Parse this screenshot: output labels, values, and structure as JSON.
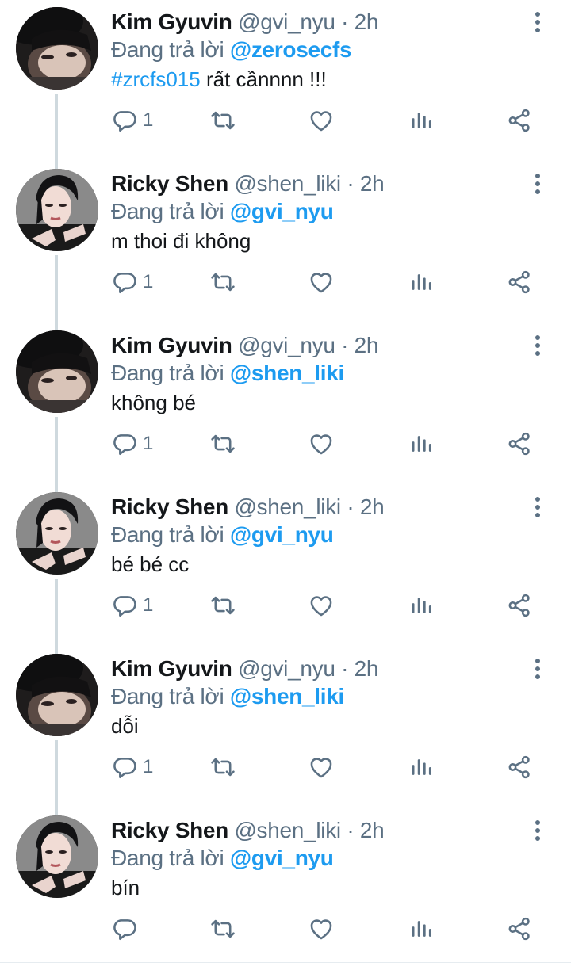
{
  "colors": {
    "accent": "#1d9bf0",
    "secondary_text": "#5b7083",
    "primary_text": "#14171a",
    "thread_line": "#cfd9de"
  },
  "tweets": [
    {
      "author": "Kim Gyuvin",
      "handle": "@gvi_nyu",
      "separator": "·",
      "time": "2h",
      "reply_prefix": "Đang trả lời",
      "reply_to": "@zerosecfs",
      "hashtag": "#zrcfs015",
      "text": " rất cầnnnn !!!",
      "reply_count": "1",
      "avatar": "kim-gyuvin-avatar"
    },
    {
      "author": "Ricky Shen",
      "handle": "@shen_liki",
      "separator": "·",
      "time": "2h",
      "reply_prefix": "Đang trả lời",
      "reply_to": "@gvi_nyu",
      "hashtag": "",
      "text": "m thoi đi không",
      "reply_count": "1",
      "avatar": "ricky-shen-avatar"
    },
    {
      "author": "Kim Gyuvin",
      "handle": "@gvi_nyu",
      "separator": "·",
      "time": "2h",
      "reply_prefix": "Đang trả lời",
      "reply_to": "@shen_liki",
      "hashtag": "",
      "text": "không bé",
      "reply_count": "1",
      "avatar": "kim-gyuvin-avatar"
    },
    {
      "author": "Ricky Shen",
      "handle": "@shen_liki",
      "separator": "·",
      "time": "2h",
      "reply_prefix": "Đang trả lời",
      "reply_to": "@gvi_nyu",
      "hashtag": "",
      "text": "bé bé cc",
      "reply_count": "1",
      "avatar": "ricky-shen-avatar"
    },
    {
      "author": "Kim Gyuvin",
      "handle": "@gvi_nyu",
      "separator": "·",
      "time": "2h",
      "reply_prefix": "Đang trả lời",
      "reply_to": "@shen_liki",
      "hashtag": "",
      "text": "dỗi",
      "reply_count": "1",
      "avatar": "kim-gyuvin-avatar"
    },
    {
      "author": "Ricky Shen",
      "handle": "@shen_liki",
      "separator": "·",
      "time": "2h",
      "reply_prefix": "Đang trả lời",
      "reply_to": "@gvi_nyu",
      "hashtag": "",
      "text": "bín",
      "reply_count": "",
      "avatar": "ricky-shen-avatar"
    }
  ],
  "icons": {
    "reply": "reply-icon",
    "retweet": "retweet-icon",
    "like": "heart-icon",
    "views": "views-icon",
    "share": "share-icon",
    "more": "more-vertical-icon"
  }
}
